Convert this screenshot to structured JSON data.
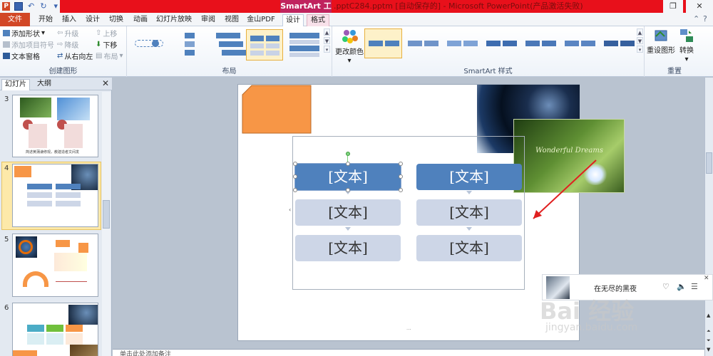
{
  "titlebar": {
    "contextual_tool": "SmartArt 工具",
    "title": ".pptC284.pptm [自动保存的] - Microsoft PowerPoint(产品激活失败)",
    "restore_icon": "restore-icon",
    "close_icon": "close-icon"
  },
  "tabs": [
    "文件",
    "开始",
    "插入",
    "设计",
    "切换",
    "动画",
    "幻灯片放映",
    "审阅",
    "视图",
    "金山PDF",
    "设计",
    "格式"
  ],
  "ribbon": {
    "create_graphic": {
      "label": "创建图形",
      "add_shape": "添加形状",
      "add_bullet": "添加项目符号",
      "text_pane": "文本窗格",
      "promote": "升级",
      "demote": "降级",
      "right_to_left": "从右向左",
      "move_up": "上移",
      "move_down": "下移",
      "layout_btn": "布局"
    },
    "layouts": {
      "label": "布局"
    },
    "styles": {
      "label": "SmartArt 样式",
      "change_colors": "更改颜色"
    },
    "reset": {
      "label": "重置",
      "reset_graphic": "重设图形",
      "convert": "转换"
    }
  },
  "left_panel": {
    "tabs": [
      "幻灯片",
      "大纲"
    ],
    "slides": [
      {
        "num": "3",
        "caption": "简述黄蒲谦修观，教建造者文间发"
      },
      {
        "num": "4"
      },
      {
        "num": "5"
      },
      {
        "num": "6"
      }
    ]
  },
  "smartart": {
    "col1": [
      "[文本]",
      "[文本]",
      "[文本]"
    ],
    "col2": [
      "[文本]",
      "[文本]",
      "[文本]"
    ]
  },
  "slide_image_caption": "Wonderful Dreams",
  "notes_placeholder": "单击此处添加备注",
  "music_player": {
    "song": "在无尽的黑夜"
  },
  "watermark": {
    "brand": "Bai 经验",
    "url": "jingyan.baidu.com"
  }
}
